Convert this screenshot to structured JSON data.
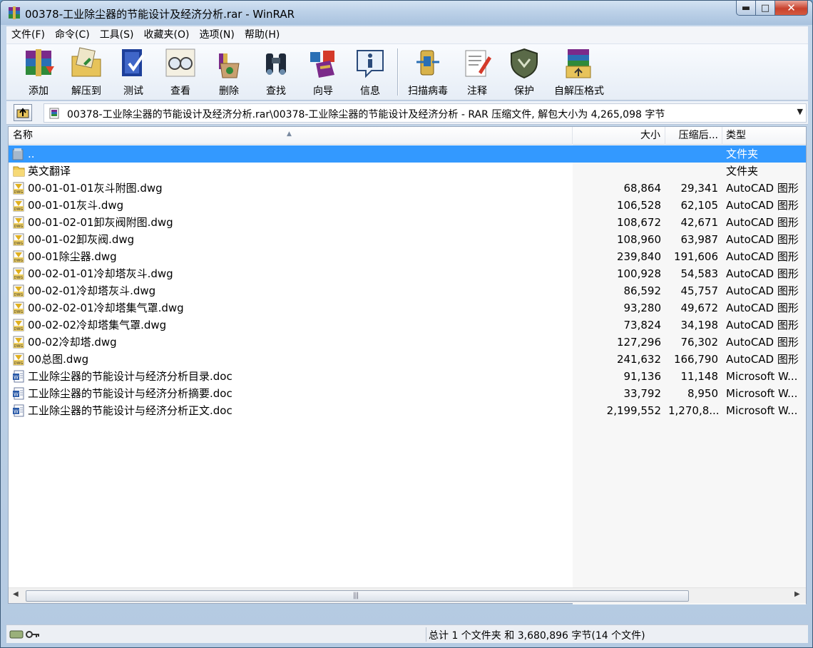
{
  "window": {
    "title": "00378-工业除尘器的节能设计及经济分析.rar - WinRAR",
    "minimize_glyph": "▬",
    "maximize_glyph": "□",
    "close_glyph": "✕"
  },
  "menu": [
    "文件(F)",
    "命令(C)",
    "工具(S)",
    "收藏夹(O)",
    "选项(N)",
    "帮助(H)"
  ],
  "toolbar": {
    "add": "添加",
    "extract_to": "解压到",
    "test": "测试",
    "view": "查看",
    "delete": "删除",
    "find": "查找",
    "wizard": "向导",
    "info": "信息",
    "virus_scan": "扫描病毒",
    "comment": "注释",
    "protect": "保护",
    "sfx": "自解压格式"
  },
  "address": {
    "text": "00378-工业除尘器的节能设计及经济分析.rar\\00378-工业除尘器的节能设计及经济分析 - RAR 压缩文件, 解包大小为 4,265,098 字节",
    "dropdown_glyph": "▼"
  },
  "columns": {
    "name": "名称",
    "size": "大小",
    "packed": "压缩后...",
    "type": "类型",
    "sort_glyph": "▲"
  },
  "files": [
    {
      "name": "..",
      "size": "",
      "packed": "",
      "type": "文件夹",
      "icon": "folder-up-icon"
    },
    {
      "name": "英文翻译",
      "size": "",
      "packed": "",
      "type": "文件夹",
      "icon": "folder-icon"
    },
    {
      "name": "00-01-01-01灰斗附图.dwg",
      "size": "68,864",
      "packed": "29,341",
      "type": "AutoCAD 图形",
      "icon": "dwg-file-icon"
    },
    {
      "name": "00-01-01灰斗.dwg",
      "size": "106,528",
      "packed": "62,105",
      "type": "AutoCAD 图形",
      "icon": "dwg-file-icon"
    },
    {
      "name": "00-01-02-01卸灰阀附图.dwg",
      "size": "108,672",
      "packed": "42,671",
      "type": "AutoCAD 图形",
      "icon": "dwg-file-icon"
    },
    {
      "name": "00-01-02卸灰阀.dwg",
      "size": "108,960",
      "packed": "63,987",
      "type": "AutoCAD 图形",
      "icon": "dwg-file-icon"
    },
    {
      "name": "00-01除尘器.dwg",
      "size": "239,840",
      "packed": "191,606",
      "type": "AutoCAD 图形",
      "icon": "dwg-file-icon"
    },
    {
      "name": "00-02-01-01冷却塔灰斗.dwg",
      "size": "100,928",
      "packed": "54,583",
      "type": "AutoCAD 图形",
      "icon": "dwg-file-icon"
    },
    {
      "name": "00-02-01冷却塔灰斗.dwg",
      "size": "86,592",
      "packed": "45,757",
      "type": "AutoCAD 图形",
      "icon": "dwg-file-icon"
    },
    {
      "name": "00-02-02-01冷却塔集气罩.dwg",
      "size": "93,280",
      "packed": "49,672",
      "type": "AutoCAD 图形",
      "icon": "dwg-file-icon"
    },
    {
      "name": "00-02-02冷却塔集气罩.dwg",
      "size": "73,824",
      "packed": "34,198",
      "type": "AutoCAD 图形",
      "icon": "dwg-file-icon"
    },
    {
      "name": "00-02冷却塔.dwg",
      "size": "127,296",
      "packed": "76,302",
      "type": "AutoCAD 图形",
      "icon": "dwg-file-icon"
    },
    {
      "name": "00总图.dwg",
      "size": "241,632",
      "packed": "166,790",
      "type": "AutoCAD 图形",
      "icon": "dwg-file-icon"
    },
    {
      "name": "工业除尘器的节能设计与经济分析目录.doc",
      "size": "91,136",
      "packed": "11,148",
      "type": "Microsoft W...",
      "icon": "word-doc-icon"
    },
    {
      "name": "工业除尘器的节能设计与经济分析摘要.doc",
      "size": "33,792",
      "packed": "8,950",
      "type": "Microsoft W...",
      "icon": "word-doc-icon"
    },
    {
      "name": "工业除尘器的节能设计与经济分析正文.doc",
      "size": "2,199,552",
      "packed": "1,270,8...",
      "type": "Microsoft W...",
      "icon": "word-doc-icon"
    }
  ],
  "scrollbar": {
    "left_glyph": "◀",
    "right_glyph": "▶",
    "grip_glyph": "|||"
  },
  "status": {
    "summary": "总计 1 个文件夹 和 3,680,896 字节(14 个文件)"
  },
  "colors": {
    "selection": "#3399ff",
    "titlebar": "#bcd1e8"
  }
}
